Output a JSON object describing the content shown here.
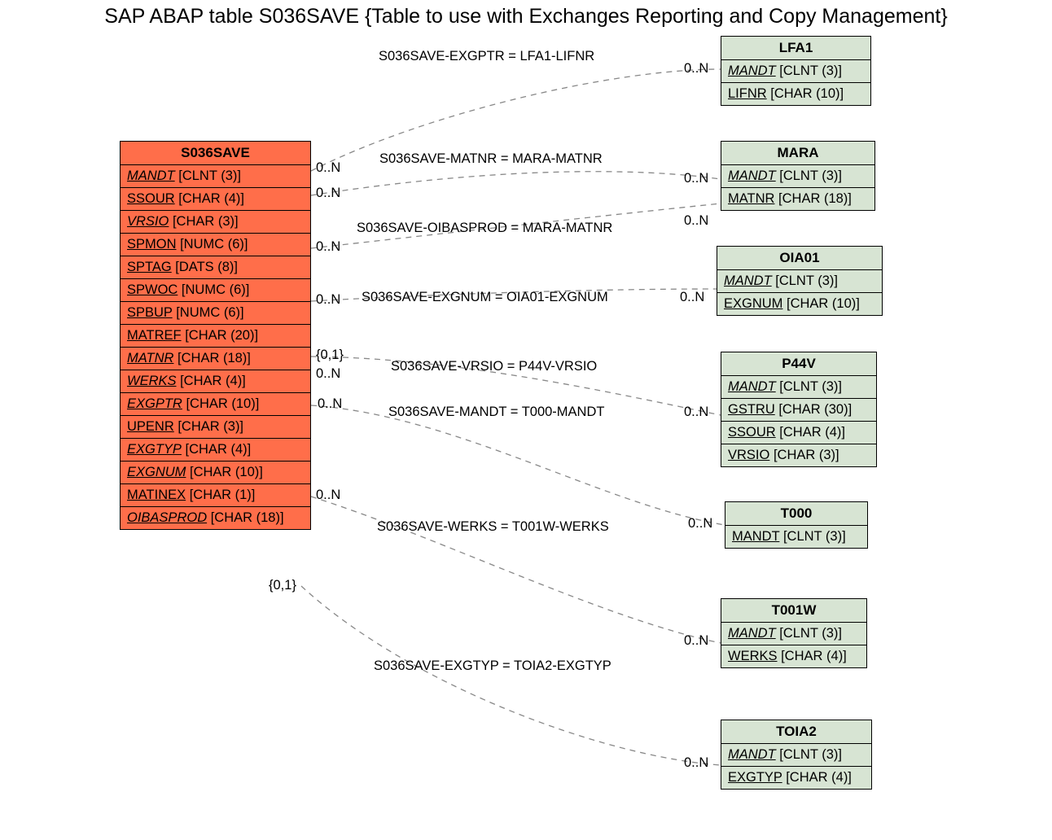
{
  "title": "SAP ABAP table S036SAVE {Table to use with Exchanges Reporting and Copy Management}",
  "main": {
    "name": "S036SAVE",
    "fields": [
      {
        "name": "MANDT",
        "type": "[CLNT (3)]",
        "ul": true,
        "it": true
      },
      {
        "name": "SSOUR",
        "type": "[CHAR (4)]",
        "ul": true,
        "it": false
      },
      {
        "name": "VRSIO",
        "type": "[CHAR (3)]",
        "ul": true,
        "it": true
      },
      {
        "name": "SPMON",
        "type": "[NUMC (6)]",
        "ul": true,
        "it": false
      },
      {
        "name": "SPTAG",
        "type": "[DATS (8)]",
        "ul": true,
        "it": false
      },
      {
        "name": "SPWOC",
        "type": "[NUMC (6)]",
        "ul": true,
        "it": false
      },
      {
        "name": "SPBUP",
        "type": "[NUMC (6)]",
        "ul": true,
        "it": false
      },
      {
        "name": "MATREF",
        "type": "[CHAR (20)]",
        "ul": true,
        "it": false
      },
      {
        "name": "MATNR",
        "type": "[CHAR (18)]",
        "ul": true,
        "it": true
      },
      {
        "name": "WERKS",
        "type": "[CHAR (4)]",
        "ul": true,
        "it": true
      },
      {
        "name": "EXGPTR",
        "type": "[CHAR (10)]",
        "ul": true,
        "it": true
      },
      {
        "name": "UPENR",
        "type": "[CHAR (3)]",
        "ul": true,
        "it": false
      },
      {
        "name": "EXGTYP",
        "type": "[CHAR (4)]",
        "ul": true,
        "it": true
      },
      {
        "name": "EXGNUM",
        "type": "[CHAR (10)]",
        "ul": true,
        "it": true
      },
      {
        "name": "MATINEX",
        "type": "[CHAR (1)]",
        "ul": true,
        "it": false
      },
      {
        "name": "OIBASPROD",
        "type": "[CHAR (18)]",
        "ul": true,
        "it": true
      }
    ]
  },
  "refs": [
    {
      "key": "LFA1",
      "name": "LFA1",
      "fields": [
        {
          "name": "MANDT",
          "type": "[CLNT (3)]",
          "ul": true,
          "it": true
        },
        {
          "name": "LIFNR",
          "type": "[CHAR (10)]",
          "ul": true,
          "it": false
        }
      ]
    },
    {
      "key": "MARA",
      "name": "MARA",
      "fields": [
        {
          "name": "MANDT",
          "type": "[CLNT (3)]",
          "ul": true,
          "it": true
        },
        {
          "name": "MATNR",
          "type": "[CHAR (18)]",
          "ul": true,
          "it": false
        }
      ]
    },
    {
      "key": "OIA01",
      "name": "OIA01",
      "fields": [
        {
          "name": "MANDT",
          "type": "[CLNT (3)]",
          "ul": true,
          "it": true
        },
        {
          "name": "EXGNUM",
          "type": "[CHAR (10)]",
          "ul": true,
          "it": false
        }
      ]
    },
    {
      "key": "P44V",
      "name": "P44V",
      "fields": [
        {
          "name": "MANDT",
          "type": "[CLNT (3)]",
          "ul": true,
          "it": true
        },
        {
          "name": "GSTRU",
          "type": "[CHAR (30)]",
          "ul": true,
          "it": false
        },
        {
          "name": "SSOUR",
          "type": "[CHAR (4)]",
          "ul": true,
          "it": false
        },
        {
          "name": "VRSIO",
          "type": "[CHAR (3)]",
          "ul": true,
          "it": false
        }
      ]
    },
    {
      "key": "T000",
      "name": "T000",
      "fields": [
        {
          "name": "MANDT",
          "type": "[CLNT (3)]",
          "ul": true,
          "it": false
        }
      ]
    },
    {
      "key": "T001W",
      "name": "T001W",
      "fields": [
        {
          "name": "MANDT",
          "type": "[CLNT (3)]",
          "ul": true,
          "it": true
        },
        {
          "name": "WERKS",
          "type": "[CHAR (4)]",
          "ul": true,
          "it": false
        }
      ]
    },
    {
      "key": "TOIA2",
      "name": "TOIA2",
      "fields": [
        {
          "name": "MANDT",
          "type": "[CLNT (3)]",
          "ul": true,
          "it": true
        },
        {
          "name": "EXGTYP",
          "type": "[CHAR (4)]",
          "ul": true,
          "it": false
        }
      ]
    }
  ],
  "edges": [
    {
      "label": "S036SAVE-EXGPTR = LFA1-LIFNR",
      "leftCard": "0..N",
      "rightCard": "0..N"
    },
    {
      "label": "S036SAVE-MATNR = MARA-MATNR",
      "leftCard": "0..N",
      "rightCard": "0..N"
    },
    {
      "label": "S036SAVE-OIBASPROD = MARA-MATNR",
      "leftCard": "0..N",
      "rightCard": "0..N"
    },
    {
      "label": "S036SAVE-EXGNUM = OIA01-EXGNUM",
      "leftCard": "0..N",
      "rightCard": "0..N"
    },
    {
      "label": "S036SAVE-VRSIO = P44V-VRSIO",
      "leftCard": "{0,1}",
      "rightCard": "0..N"
    },
    {
      "label": "S036SAVE-MANDT = T000-MANDT",
      "leftCard": "0..N",
      "rightCard": "0..N"
    },
    {
      "label": "S036SAVE-WERKS = T001W-WERKS",
      "leftCard": "0..N",
      "rightCard": "0..N"
    },
    {
      "label": "S036SAVE-EXGTYP = TOIA2-EXGTYP",
      "leftCard": "{0,1}",
      "rightCard": "0..N"
    }
  ],
  "chart_data": {
    "type": "table",
    "title": "SAP ABAP table S036SAVE — ER relationships",
    "main_table": "S036SAVE",
    "main_fields": [
      "MANDT",
      "SSOUR",
      "VRSIO",
      "SPMON",
      "SPTAG",
      "SPWOC",
      "SPBUP",
      "MATREF",
      "MATNR",
      "WERKS",
      "EXGPTR",
      "UPENR",
      "EXGTYP",
      "EXGNUM",
      "MATINEX",
      "OIBASPROD"
    ],
    "relationships": [
      {
        "from": "S036SAVE.EXGPTR",
        "to": "LFA1.LIFNR",
        "left": "0..N",
        "right": "0..N"
      },
      {
        "from": "S036SAVE.MATNR",
        "to": "MARA.MATNR",
        "left": "0..N",
        "right": "0..N"
      },
      {
        "from": "S036SAVE.OIBASPROD",
        "to": "MARA.MATNR",
        "left": "0..N",
        "right": "0..N"
      },
      {
        "from": "S036SAVE.EXGNUM",
        "to": "OIA01.EXGNUM",
        "left": "0..N",
        "right": "0..N"
      },
      {
        "from": "S036SAVE.VRSIO",
        "to": "P44V.VRSIO",
        "left": "{0,1}",
        "right": "0..N"
      },
      {
        "from": "S036SAVE.MANDT",
        "to": "T000.MANDT",
        "left": "0..N",
        "right": "0..N"
      },
      {
        "from": "S036SAVE.WERKS",
        "to": "T001W.WERKS",
        "left": "0..N",
        "right": "0..N"
      },
      {
        "from": "S036SAVE.EXGTYP",
        "to": "TOIA2.EXGTYP",
        "left": "{0,1}",
        "right": "0..N"
      }
    ]
  }
}
